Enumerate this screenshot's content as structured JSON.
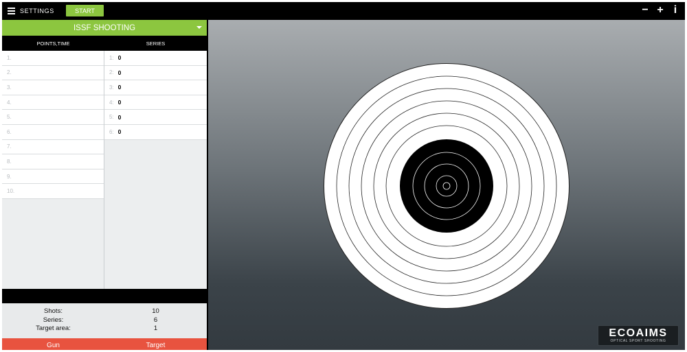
{
  "topbar": {
    "menu_label": "SETTINGS",
    "start_label": "START",
    "icons": [
      "minus-icon",
      "plus-icon",
      "info-icon"
    ],
    "minus_glyph": "−",
    "plus_glyph": "+",
    "info_glyph": "i"
  },
  "mode": {
    "selected": "ISSF SHOOTING"
  },
  "table": {
    "col_points": "POINTS,TIME",
    "col_series": "SERIES",
    "points_rows": [
      "1.",
      "2.",
      "3.",
      "4.",
      "5.",
      "6.",
      "7.",
      "8.",
      "9.",
      "10."
    ],
    "series_rows": [
      {
        "num": "1:",
        "value": "0"
      },
      {
        "num": "2:",
        "value": "0"
      },
      {
        "num": "3:",
        "value": "0"
      },
      {
        "num": "4:",
        "value": "0"
      },
      {
        "num": "5:",
        "value": "0"
      },
      {
        "num": "6:",
        "value": "0"
      }
    ]
  },
  "stats": [
    {
      "label": "Shots:",
      "value": "10"
    },
    {
      "label": "Series:",
      "value": "6"
    },
    {
      "label": "Target area:",
      "value": "1"
    }
  ],
  "tabs": {
    "gun": "Gun",
    "target": "Target"
  },
  "logo": {
    "big": "ECOAIMS",
    "small": "OPTICAL SPORT SHOOTING"
  },
  "colors": {
    "accent": "#8cc63f",
    "tab": "#e8533f"
  }
}
